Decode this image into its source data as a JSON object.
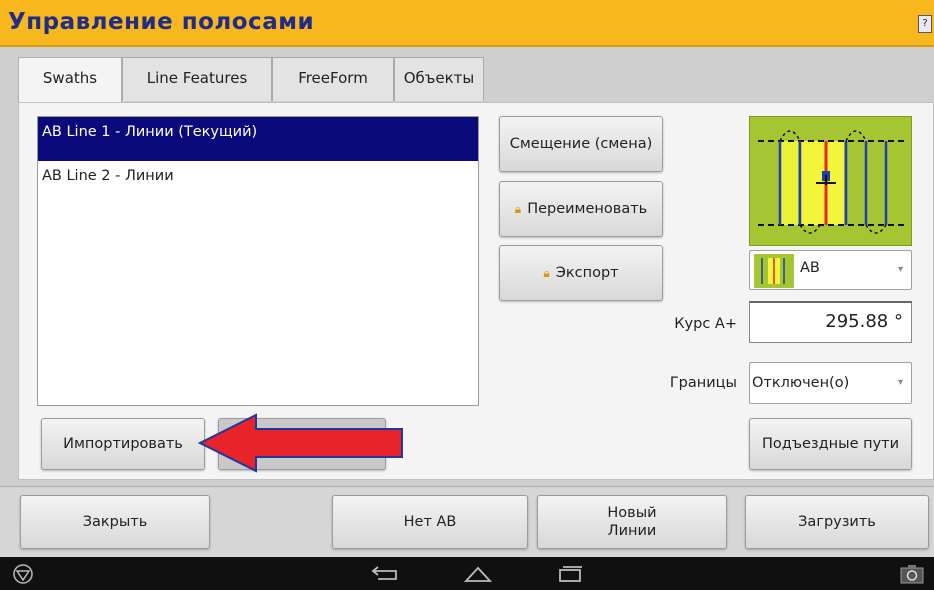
{
  "window": {
    "title": "Управление полосами",
    "help_label": "?"
  },
  "tabs": [
    {
      "label": "Swaths",
      "active": true
    },
    {
      "label": "Line Features",
      "active": false
    },
    {
      "label": "FreeForm",
      "active": false
    },
    {
      "label": "Объекты",
      "active": false
    }
  ],
  "lines": [
    {
      "label": "AB Line 1 - Линии (Текущий)",
      "selected": true
    },
    {
      "label": "AB Line 2 - Линии",
      "selected": false
    }
  ],
  "actions": {
    "shift": "Смещение (смена)",
    "rename": "Переименовать",
    "export": "Экспорт",
    "import": "Импортировать"
  },
  "pattern": {
    "selected": "AB"
  },
  "heading": {
    "label": "Курс A+",
    "value": "295.88 °"
  },
  "boundaries": {
    "label": "Границы",
    "value": "Отключен(о)"
  },
  "access_paths": "Подъездные пути",
  "footer": {
    "close": "Закрыть",
    "no_ab": "Нет AB",
    "new_lines_line1": "Новый",
    "new_lines_line2": "Линии",
    "load": "Загрузить"
  },
  "colors": {
    "title_bar": "#f7b71d",
    "title_text": "#1f2d86",
    "selection": "#0a0a7a",
    "field_green": "#a6c532",
    "arrow_red": "#e8232a",
    "arrow_border": "#1a3aa0"
  },
  "icons": {
    "lock": "lock-icon",
    "dropdown": "chevron-down-icon",
    "nav_home": "trimble-logo-icon",
    "nav_back": "back-icon",
    "nav_home_btn": "home-icon",
    "nav_recent": "recent-apps-icon",
    "nav_screenshot": "camera-icon"
  }
}
